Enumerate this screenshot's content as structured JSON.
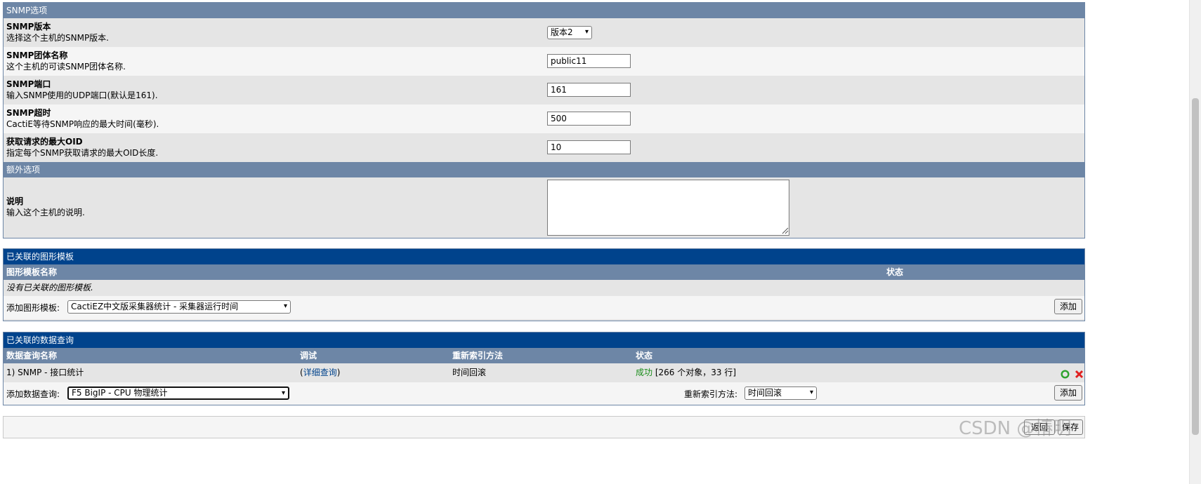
{
  "snmp_section": {
    "header": "SNMP选项",
    "version": {
      "title": "SNMP版本",
      "desc": "选择这个主机的SNMP版本.",
      "value": "版本2"
    },
    "community": {
      "title": "SNMP团体名称",
      "desc": "这个主机的可读SNMP团体名称.",
      "value": "public11"
    },
    "port": {
      "title": "SNMP端口",
      "desc": "输入SNMP使用的UDP端口(默认是161).",
      "value": "161"
    },
    "timeout": {
      "title": "SNMP超时",
      "desc": "CactiE等待SNMP响应的最大时间(毫秒).",
      "value": "500"
    },
    "max_oid": {
      "title": "获取请求的最大OID",
      "desc": "指定每个SNMP获取请求的最大OID长度.",
      "value": "10"
    }
  },
  "extra_section": {
    "header": "额外选项",
    "notes": {
      "title": "说明",
      "desc": "输入这个主机的说明.",
      "value": ""
    }
  },
  "graph_templates": {
    "header": "已关联的图形模板",
    "col_name": "图形模板名称",
    "col_status": "状态",
    "empty_text": "没有已关联的图形模板.",
    "add_label": "添加图形模板:",
    "add_selected": "CactiEZ中文版采集器统计 - 采集器运行时间",
    "add_button": "添加"
  },
  "data_queries": {
    "header": "已关联的数据查询",
    "columns": [
      "数据查询名称",
      "调试",
      "重新索引方法",
      "状态"
    ],
    "rows": [
      {
        "name": "1) SNMP - 接口统计",
        "debug_open": "(",
        "debug_link": "详细查询",
        "debug_close": ")",
        "reindex": "时间回滚",
        "status_ok": "成功",
        "status_detail": "[266 个对象，33 行]"
      }
    ],
    "add_label": "添加数据查询:",
    "add_selected": "F5 BigIP - CPU 物理统计",
    "reindex_label": "重新索引方法:",
    "reindex_selected": "时间回滚",
    "add_button": "添加"
  },
  "footer": {
    "back_button": "返回",
    "save_button": "保存",
    "watermark": "CSDN @椿明"
  },
  "colors": {
    "section_header": "#6d86a6",
    "panel_header": "#00438c",
    "row_light": "#f5f5f5",
    "row_dark": "#e5e5e5",
    "success": "#198c19",
    "delete": "#e02020"
  }
}
